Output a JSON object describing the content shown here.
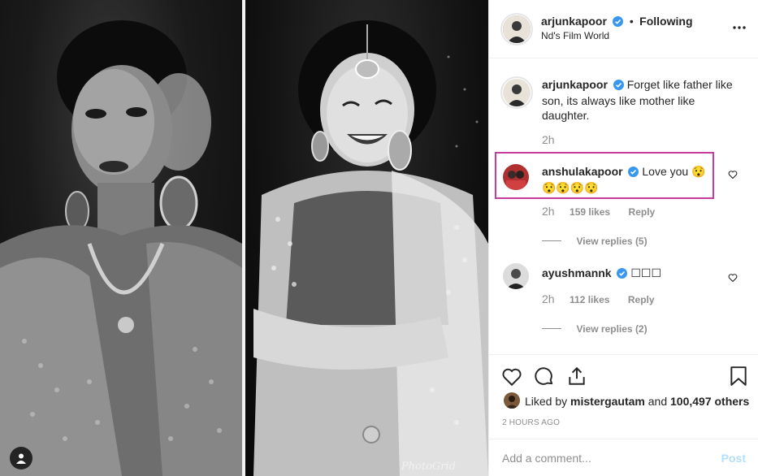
{
  "post": {
    "photo_watermark": "PhotoGrid"
  },
  "header": {
    "username": "arjunkapoor",
    "separator": "•",
    "follow_state": "Following",
    "location": "Nd's Film World",
    "more_icon": "more-horizontal-icon"
  },
  "caption": {
    "username": "arjunkapoor",
    "text": "Forget like father like son, its always like mother like daughter.",
    "time": "2h"
  },
  "comments": [
    {
      "username": "anshulakapoor",
      "text": "Love you 😯😯😯😯😯",
      "time": "2h",
      "likes": "159 likes",
      "reply_label": "Reply",
      "view_replies": "View replies (5)"
    },
    {
      "username": "ayushmannk",
      "text": "☐☐☐",
      "time": "2h",
      "likes": "112 likes",
      "reply_label": "Reply",
      "view_replies": "View replies (2)"
    }
  ],
  "likes_line": {
    "prefix": "Liked by",
    "user": "mistergautam",
    "and": "and",
    "others": "100,497 others"
  },
  "timestamp": "2 HOURS AGO",
  "add_comment": {
    "placeholder": "Add a comment...",
    "post_label": "Post"
  },
  "colors": {
    "verified": "#3897f0",
    "link": "#b2dffc",
    "highlight": "#c83d9b"
  }
}
